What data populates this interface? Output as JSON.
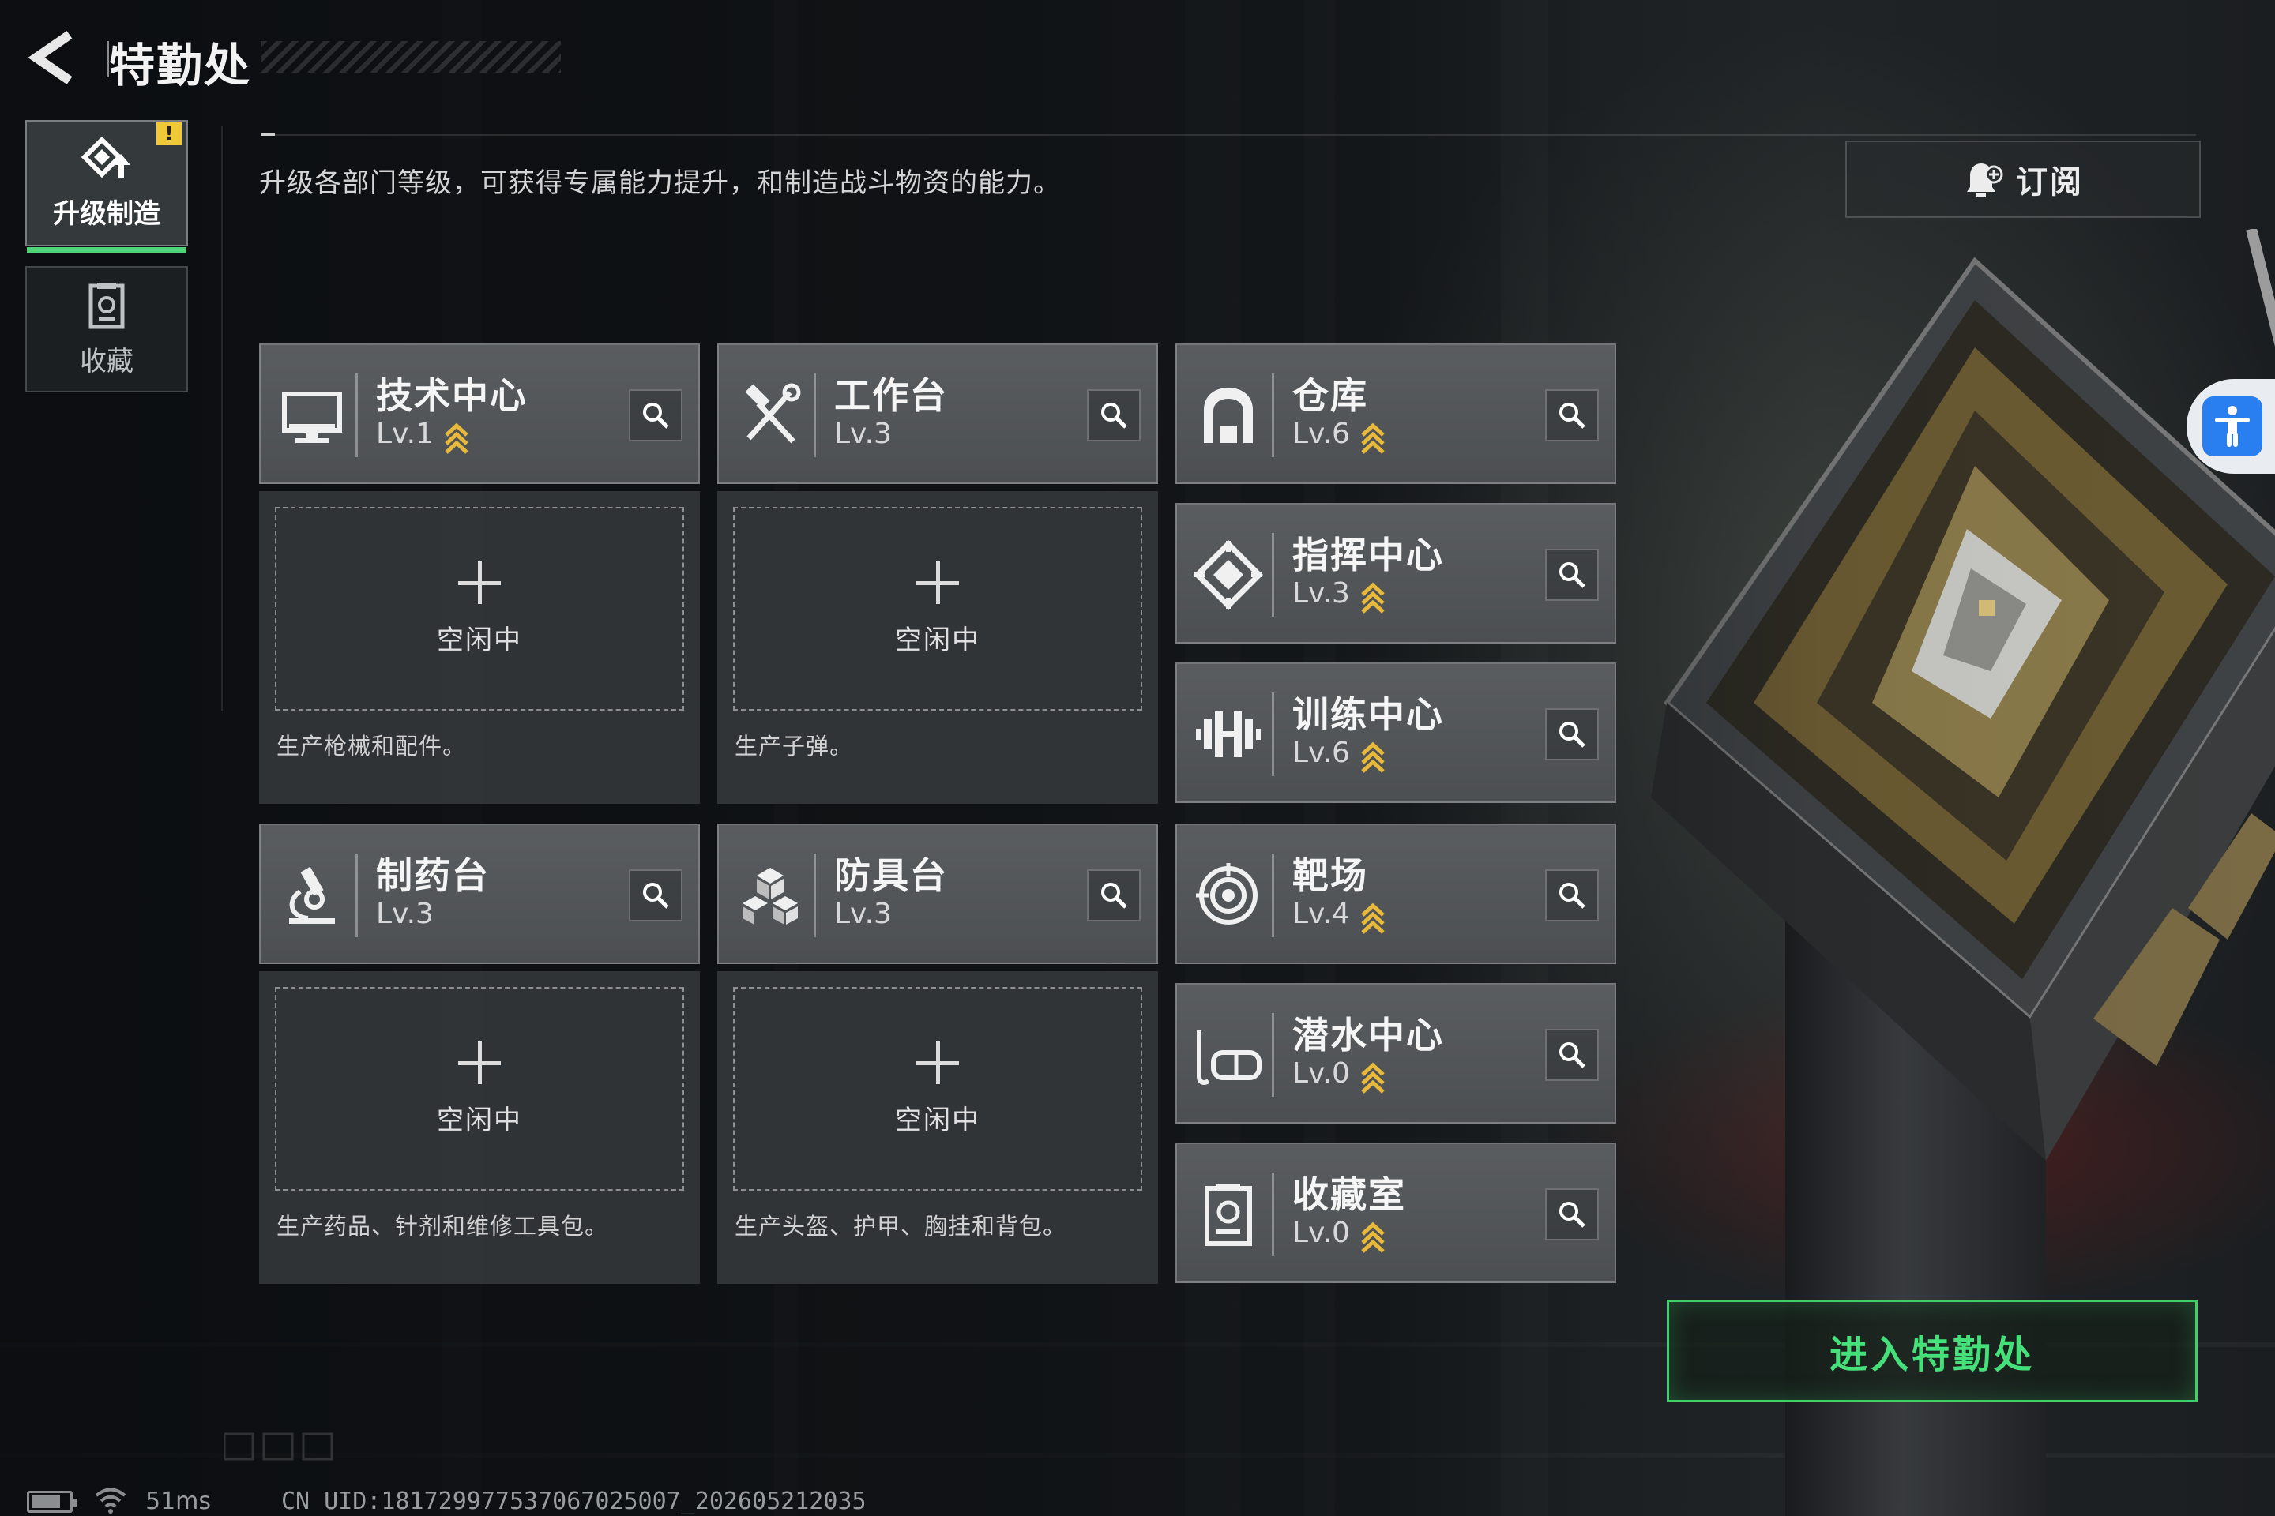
{
  "header": {
    "title": "特勤处",
    "back_label": "back"
  },
  "side_tabs": [
    {
      "label": "升级制造",
      "icon": "upgrade-icon",
      "selected": true,
      "alert": "!"
    },
    {
      "label": "收藏",
      "icon": "collection-icon",
      "selected": false
    }
  ],
  "description": "升级各部门等级，可获得专属能力提升，和制造战斗物资的能力。",
  "subscribe": {
    "label": "订阅",
    "icon": "bell-plus-icon"
  },
  "departments": [
    {
      "name": "技术中心",
      "level": "Lv.1",
      "upgradable": true,
      "icon": "monitor-icon"
    },
    {
      "name": "工作台",
      "level": "Lv.3",
      "upgradable": false,
      "icon": "tools-icon"
    },
    {
      "name": "仓库",
      "level": "Lv.6",
      "upgradable": true,
      "icon": "warehouse-icon"
    },
    {
      "name": "指挥中心",
      "level": "Lv.3",
      "upgradable": true,
      "icon": "command-icon"
    },
    {
      "name": "训练中心",
      "level": "Lv.6",
      "upgradable": true,
      "icon": "dumbbell-icon"
    },
    {
      "name": "制药台",
      "level": "Lv.3",
      "upgradable": false,
      "icon": "microscope-icon"
    },
    {
      "name": "防具台",
      "level": "Lv.3",
      "upgradable": false,
      "icon": "armor-icon"
    },
    {
      "name": "靶场",
      "level": "Lv.4",
      "upgradable": true,
      "icon": "target-icon"
    },
    {
      "name": "潜水中心",
      "level": "Lv.0",
      "upgradable": true,
      "icon": "diving-mask-icon"
    },
    {
      "name": "收藏室",
      "level": "Lv.0",
      "upgradable": true,
      "icon": "collection-room-icon"
    }
  ],
  "production_slots": [
    {
      "status": "空闲中",
      "description": "生产枪械和配件。"
    },
    {
      "status": "空闲中",
      "description": "生产子弹。"
    },
    {
      "status": "空闲中",
      "description": "生产药品、针剂和维修工具包。"
    },
    {
      "status": "空闲中",
      "description": "生产头盔、护甲、胸挂和背包。"
    }
  ],
  "enter_button": {
    "label": "进入特勤处"
  },
  "status_bar": {
    "ping": "51ms",
    "uid": "CN UID:18172997753706702500​7_202605212035"
  },
  "colors": {
    "accent_green": "#46e07a",
    "upgrade_gold": "#e8b93a",
    "alert_yellow": "#f0c93a",
    "a11y_blue": "#2a7ff0"
  }
}
